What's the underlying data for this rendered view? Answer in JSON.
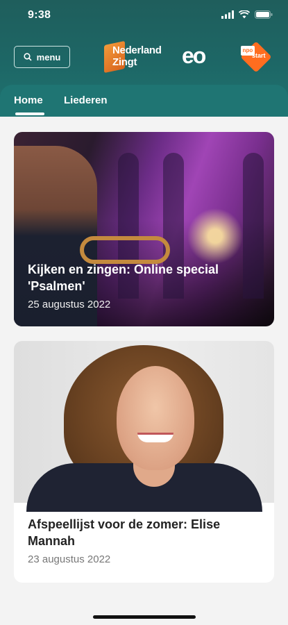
{
  "status_bar": {
    "time": "9:38"
  },
  "header": {
    "menu_label": "menu",
    "logos": {
      "nederland_zingt": "Nederland Zingt",
      "eo": "eo",
      "npo": "npo",
      "start": "start"
    }
  },
  "tabs": [
    {
      "label": "Home",
      "selected": true
    },
    {
      "label": "Liederen",
      "selected": false
    }
  ],
  "articles": [
    {
      "title": "Kijken en zingen: Online special 'Psalmen'",
      "date": "25 augustus 2022"
    },
    {
      "title": "Afspeellijst voor de zomer: Elise Mannah",
      "date": "23 augustus 2022"
    }
  ],
  "colors": {
    "header": "#1f6e6c",
    "accent": "#ff6d1f",
    "background": "#f3f3f3"
  }
}
